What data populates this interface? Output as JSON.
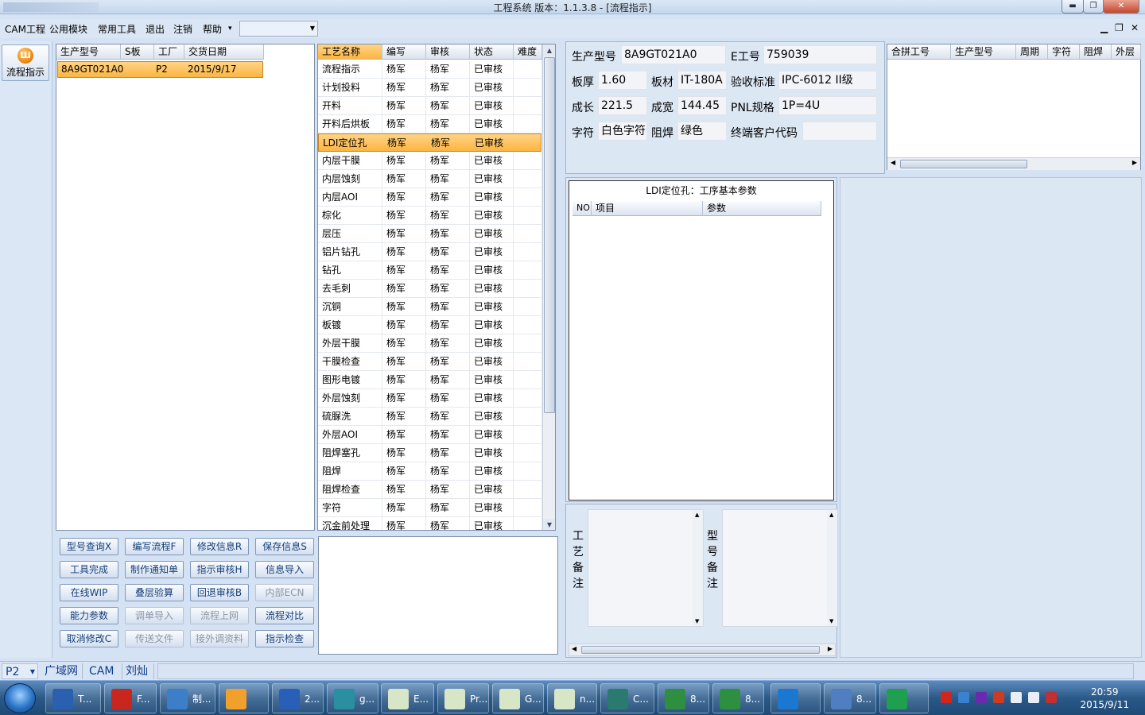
{
  "window": {
    "title": "工程系统    版本：1.1.3.8 - [流程指示]",
    "min_label": "▬",
    "max_label": "❐",
    "close_label": "✕"
  },
  "menu": {
    "items": [
      "CAM工程",
      "公用模块",
      "常用工具",
      "退出",
      "注销",
      "帮助"
    ],
    "help_arrow": "▾",
    "combo_value": "",
    "mdi_min": "▁",
    "mdi_restore": "❐",
    "mdi_close": "✕"
  },
  "nav": {
    "button_label": "流程指示"
  },
  "model_grid": {
    "headers": [
      "生产型号",
      "S板",
      "工厂",
      "交货日期"
    ],
    "rows": [
      [
        "8A9GT021A0",
        "",
        "P2",
        "2015/9/17"
      ]
    ]
  },
  "process_grid": {
    "headers": [
      "工艺名称",
      "编写",
      "审核",
      "状态",
      "难度"
    ],
    "rows": [
      [
        "流程指示",
        "杨军",
        "杨军",
        "已审核",
        ""
      ],
      [
        "计划投料",
        "杨军",
        "杨军",
        "已审核",
        ""
      ],
      [
        "开料",
        "杨军",
        "杨军",
        "已审核",
        ""
      ],
      [
        "开料后烘板",
        "杨军",
        "杨军",
        "已审核",
        ""
      ],
      [
        "LDI定位孔",
        "杨军",
        "杨军",
        "已审核",
        ""
      ],
      [
        "内层干膜",
        "杨军",
        "杨军",
        "已审核",
        ""
      ],
      [
        "内层蚀刻",
        "杨军",
        "杨军",
        "已审核",
        ""
      ],
      [
        "内层AOI",
        "杨军",
        "杨军",
        "已审核",
        ""
      ],
      [
        "棕化",
        "杨军",
        "杨军",
        "已审核",
        ""
      ],
      [
        "层压",
        "杨军",
        "杨军",
        "已审核",
        ""
      ],
      [
        "铝片钻孔",
        "杨军",
        "杨军",
        "已审核",
        ""
      ],
      [
        "钻孔",
        "杨军",
        "杨军",
        "已审核",
        ""
      ],
      [
        "去毛刺",
        "杨军",
        "杨军",
        "已审核",
        ""
      ],
      [
        "沉铜",
        "杨军",
        "杨军",
        "已审核",
        ""
      ],
      [
        "板镀",
        "杨军",
        "杨军",
        "已审核",
        ""
      ],
      [
        "外层干膜",
        "杨军",
        "杨军",
        "已审核",
        ""
      ],
      [
        "干膜检查",
        "杨军",
        "杨军",
        "已审核",
        ""
      ],
      [
        "图形电镀",
        "杨军",
        "杨军",
        "已审核",
        ""
      ],
      [
        "外层蚀刻",
        "杨军",
        "杨军",
        "已审核",
        ""
      ],
      [
        "硫脲洗",
        "杨军",
        "杨军",
        "已审核",
        ""
      ],
      [
        "外层AOI",
        "杨军",
        "杨军",
        "已审核",
        ""
      ],
      [
        "阻焊塞孔",
        "杨军",
        "杨军",
        "已审核",
        ""
      ],
      [
        "阻焊",
        "杨军",
        "杨军",
        "已审核",
        ""
      ],
      [
        "阻焊检查",
        "杨军",
        "杨军",
        "已审核",
        ""
      ],
      [
        "字符",
        "杨军",
        "杨军",
        "已审核",
        ""
      ],
      [
        "沉金前处理",
        "杨军",
        "杨军",
        "已审核",
        ""
      ]
    ],
    "selected_index": 4
  },
  "actions": [
    [
      "型号查询X",
      "编写流程F",
      "修改信息R",
      "保存信息S"
    ],
    [
      "工具完成",
      "制作通知单",
      "指示审核H",
      "信息导入"
    ],
    [
      "在线WIP",
      "叠层验算",
      "回退审核B",
      "内部ECN"
    ],
    [
      "能力参数",
      "调单导入",
      "流程上网",
      "流程对比"
    ],
    [
      "取消修改C",
      "传送文件",
      "接外调资料",
      "指示检查"
    ]
  ],
  "disabled_actions": [
    "内部ECN",
    "调单导入",
    "流程上网",
    "传送文件",
    "接外调资料"
  ],
  "info": {
    "model_label": "生产型号",
    "model_value": "8A9GT021A0",
    "e_label": "E工号",
    "e_value": "759039",
    "thick_label": "板厚",
    "thick_value": "1.60",
    "mat_label": "板材",
    "mat_value": "IT-180A",
    "std_label": "验收标准",
    "std_value": "IPC-6012 II级",
    "len_label": "成长",
    "len_value": "221.5",
    "wid_label": "成宽",
    "wid_value": "144.45",
    "pnl_label": "PNL规格",
    "pnl_value": "1P=4U",
    "char_label": "字符",
    "char_value": "白色字符",
    "mask_label": "阻焊",
    "mask_value": "绿色",
    "cust_label": "终端客户代码",
    "cust_value": ""
  },
  "merge_grid": {
    "headers": [
      "合拼工号",
      "生产型号",
      "周期",
      "字符",
      "阻焊",
      "外层"
    ]
  },
  "params": {
    "title": "LDI定位孔：工序基本参数",
    "headers": [
      "NO",
      "项目",
      "参数"
    ]
  },
  "remarks": {
    "process_label": "工艺备注",
    "model_label": "型号备注"
  },
  "status": {
    "combo": "P2",
    "items": [
      "广域网",
      "CAM",
      "刘灿"
    ]
  },
  "taskbar": {
    "items": [
      "T...",
      "F...",
      "制...",
      "",
      "2...",
      "g...",
      "E...",
      "Pr...",
      "G...",
      "n...",
      "C...",
      "8...",
      "8...",
      "",
      "8...",
      ""
    ],
    "time": "20:59",
    "date": "2015/9/11"
  },
  "colors": {
    "selection": "#fcb541",
    "button_text": "#143f7a",
    "status_text": "#0e3e8c"
  }
}
